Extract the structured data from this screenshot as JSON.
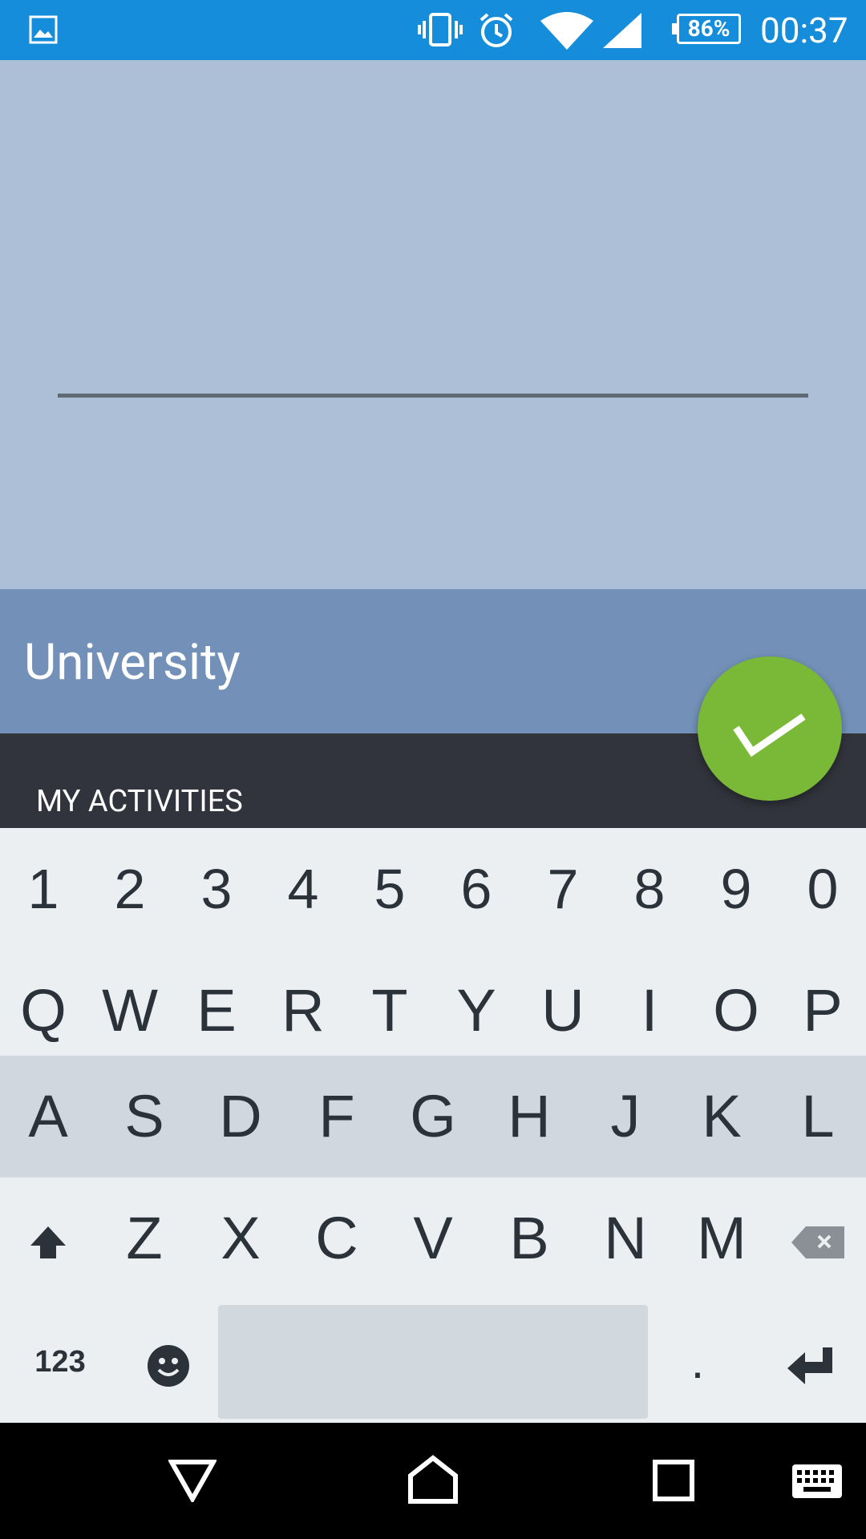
{
  "status_bar": {
    "battery": "86%",
    "time": "00:37",
    "icons": [
      "gallery-icon",
      "vibrate-icon",
      "alarm-icon",
      "wifi-icon",
      "signal-icon",
      "battery-icon"
    ]
  },
  "main": {
    "name_value": "",
    "title": "University",
    "section_label": "MY ACTIVITIES",
    "fab_icon": "check-icon",
    "colors": {
      "status_bar": "#158dda",
      "input_area": "#adbfd7",
      "title_band": "#7391b8",
      "dark_band": "#32343d",
      "fab": "#7ab838"
    }
  },
  "keyboard": {
    "numbers": [
      "1",
      "2",
      "3",
      "4",
      "5",
      "6",
      "7",
      "8",
      "9",
      "0"
    ],
    "row1": [
      "Q",
      "W",
      "E",
      "R",
      "T",
      "Y",
      "U",
      "I",
      "O",
      "P"
    ],
    "row2": [
      "A",
      "S",
      "D",
      "F",
      "G",
      "H",
      "J",
      "K",
      "L"
    ],
    "row3": [
      "Z",
      "X",
      "C",
      "V",
      "B",
      "N",
      "M"
    ],
    "bottom": {
      "symbols_label": "123",
      "period": "."
    }
  },
  "nav_bar": {
    "icons": [
      "back-icon",
      "home-icon",
      "recents-icon",
      "keyboard-switch-icon"
    ]
  }
}
